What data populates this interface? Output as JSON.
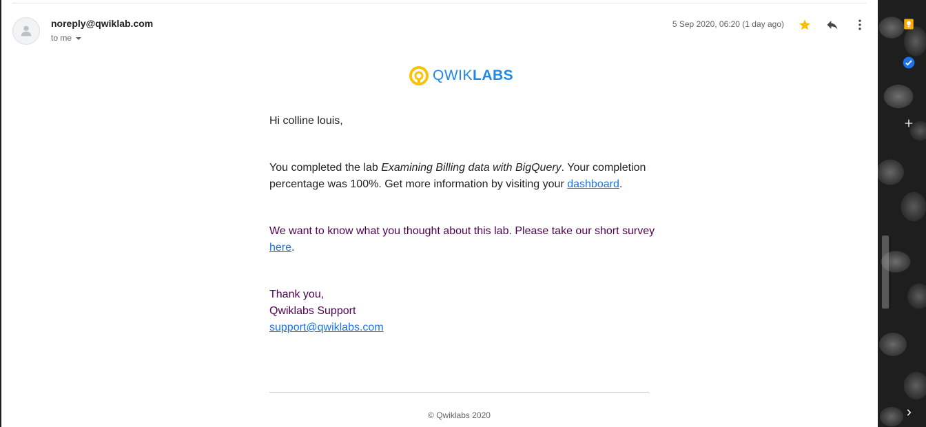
{
  "header": {
    "sender": "noreply@qwiklab.com",
    "recipient_label": "to me",
    "timestamp": "5 Sep 2020, 06:20 (1 day ago)",
    "star_color": "#fbbc04"
  },
  "email": {
    "logo": {
      "prefix": "QWIK",
      "suffix": "LABS",
      "color": "#1e88e5",
      "icon_color": "#f9c20a"
    },
    "greeting": "Hi colline louis,",
    "para1": {
      "pre": "You completed the lab ",
      "lab_name": "Examining Billing data with BigQuery",
      "mid": ". Your completion percentage was 100%. Get more information by visiting your ",
      "link": "dashboard",
      "post": "."
    },
    "para2": {
      "pre": "We want to know what you thought about this lab. Please take our short survey ",
      "link": "here",
      "post": "."
    },
    "signoff": {
      "thanks": "Thank you,",
      "team": "Qwiklabs Support",
      "email": "support@qwiklabs.com"
    },
    "copyright": "© Qwiklabs 2020"
  },
  "side_panel": {
    "icons": [
      "keep-icon",
      "tasks-icon",
      "add-icon",
      "expand-icon"
    ]
  }
}
